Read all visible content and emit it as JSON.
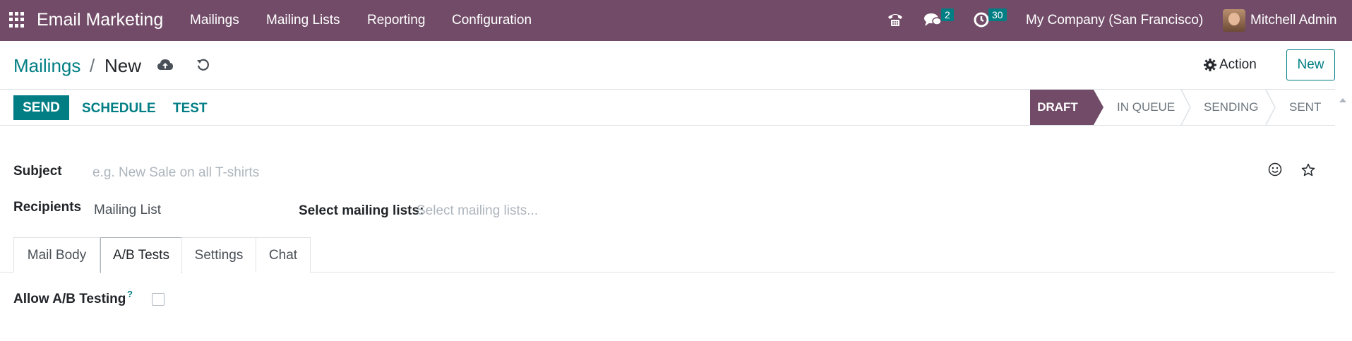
{
  "navbar": {
    "app_name": "Email Marketing",
    "menu": [
      "Mailings",
      "Mailing Lists",
      "Reporting",
      "Configuration"
    ],
    "messages_count": "2",
    "activities_count": "30",
    "company": "My Company (San Francisco)",
    "user": "Mitchell Admin"
  },
  "control_panel": {
    "breadcrumb_parent": "Mailings",
    "breadcrumb_separator": "/",
    "breadcrumb_current": "New",
    "action_label": "Action",
    "new_label": "New"
  },
  "statusbar": {
    "send_label": "SEND",
    "schedule_label": "SCHEDULE",
    "test_label": "TEST",
    "stages": [
      "DRAFT",
      "IN QUEUE",
      "SENDING",
      "SENT"
    ],
    "active_stage": "DRAFT"
  },
  "form": {
    "subject_label": "Subject",
    "subject_placeholder": "e.g. New Sale on all T-shirts",
    "recipients_label": "Recipients",
    "recipients_value": "Mailing List",
    "mailing_lists_label": "Select mailing lists:",
    "mailing_lists_placeholder": "Select mailing lists..."
  },
  "tabs": [
    "Mail Body",
    "A/B Tests",
    "Settings",
    "Chat"
  ],
  "active_tab": "A/B Tests",
  "ab_tests": {
    "allow_label": "Allow A/B Testing",
    "help_mark": "?",
    "allow_checked": false
  },
  "colors": {
    "brand": "#714b67",
    "accent": "#017e84"
  }
}
